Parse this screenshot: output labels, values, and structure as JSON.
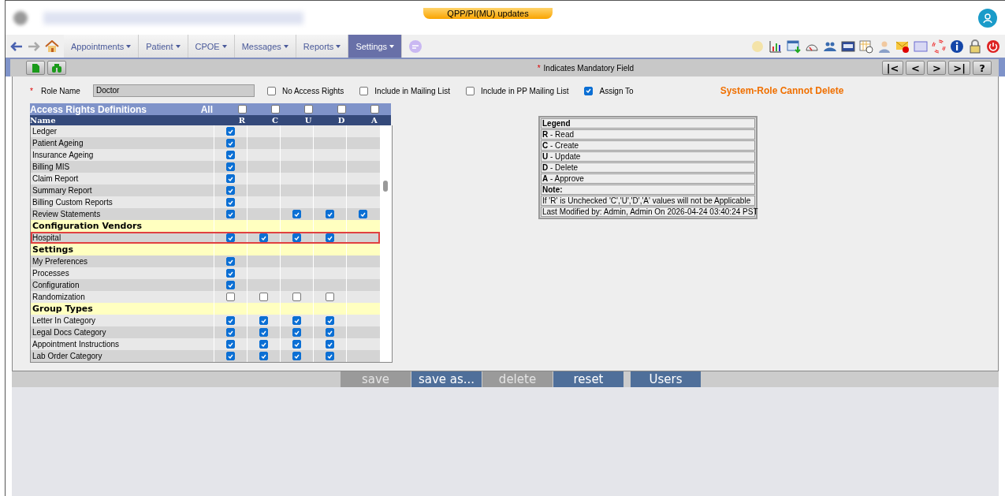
{
  "banner": {
    "label": "QPP/PI(MU) updates"
  },
  "nav": [
    {
      "label": "Appointments",
      "selected": false
    },
    {
      "label": "Patient",
      "selected": false
    },
    {
      "label": "CPOE",
      "selected": false
    },
    {
      "label": "Messages",
      "selected": false
    },
    {
      "label": "Reports",
      "selected": false
    },
    {
      "label": "Settings",
      "selected": true
    }
  ],
  "toolbar": {
    "required_mark": "*",
    "mandatory_note": "Indicates Mandatory Field",
    "pager": [
      "|<",
      "<",
      ">",
      ">|",
      "?"
    ]
  },
  "form": {
    "required_mark": "*",
    "role_label": "Role Name",
    "role_value": "Doctor",
    "options": [
      {
        "label": "No Access Rights",
        "checked": false
      },
      {
        "label": "Include in Mailing List",
        "checked": false
      },
      {
        "label": "Include in PP Mailing List",
        "checked": false
      },
      {
        "label": "Assign To",
        "checked": true
      }
    ],
    "notice": "System-Role Cannot Delete"
  },
  "grid": {
    "title": "Access Rights Definitions",
    "all_label": "All",
    "all_checks": [
      false,
      false,
      false,
      false,
      false
    ],
    "name_label": "Name",
    "columns": [
      "R",
      "C",
      "U",
      "D",
      "A"
    ],
    "rows": [
      {
        "kind": "item",
        "name": "Ledger",
        "selected": false,
        "cells": [
          {
            "kind": "checkbox",
            "checked": true
          },
          {
            "kind": "empty"
          },
          {
            "kind": "empty"
          },
          {
            "kind": "empty"
          },
          {
            "kind": "empty"
          }
        ]
      },
      {
        "kind": "item",
        "name": "Patient Ageing",
        "selected": false,
        "cells": [
          {
            "kind": "checkbox",
            "checked": true
          },
          {
            "kind": "empty"
          },
          {
            "kind": "empty"
          },
          {
            "kind": "empty"
          },
          {
            "kind": "empty"
          }
        ]
      },
      {
        "kind": "item",
        "name": "Insurance Ageing",
        "selected": false,
        "cells": [
          {
            "kind": "checkbox",
            "checked": true
          },
          {
            "kind": "empty"
          },
          {
            "kind": "empty"
          },
          {
            "kind": "empty"
          },
          {
            "kind": "empty"
          }
        ]
      },
      {
        "kind": "item",
        "name": "Billing MIS",
        "selected": false,
        "cells": [
          {
            "kind": "checkbox",
            "checked": true
          },
          {
            "kind": "empty"
          },
          {
            "kind": "empty"
          },
          {
            "kind": "empty"
          },
          {
            "kind": "empty"
          }
        ]
      },
      {
        "kind": "item",
        "name": "Claim Report",
        "selected": false,
        "cells": [
          {
            "kind": "checkbox",
            "checked": true
          },
          {
            "kind": "empty"
          },
          {
            "kind": "empty"
          },
          {
            "kind": "empty"
          },
          {
            "kind": "empty"
          }
        ]
      },
      {
        "kind": "item",
        "name": "Summary Report",
        "selected": false,
        "cells": [
          {
            "kind": "checkbox",
            "checked": true
          },
          {
            "kind": "empty"
          },
          {
            "kind": "empty"
          },
          {
            "kind": "empty"
          },
          {
            "kind": "empty"
          }
        ]
      },
      {
        "kind": "item",
        "name": "Billing Custom Reports",
        "selected": false,
        "cells": [
          {
            "kind": "checkbox",
            "checked": true
          },
          {
            "kind": "empty"
          },
          {
            "kind": "empty"
          },
          {
            "kind": "empty"
          },
          {
            "kind": "empty"
          }
        ]
      },
      {
        "kind": "item",
        "name": "Review Statements",
        "selected": false,
        "cells": [
          {
            "kind": "checkbox",
            "checked": true
          },
          {
            "kind": "empty"
          },
          {
            "kind": "checkbox",
            "checked": true
          },
          {
            "kind": "checkbox",
            "checked": true
          },
          {
            "kind": "checkbox",
            "checked": true
          }
        ]
      },
      {
        "kind": "group",
        "name": "Configuration Vendors"
      },
      {
        "kind": "item",
        "name": "Hospital",
        "selected": true,
        "cells": [
          {
            "kind": "checkbox",
            "checked": true
          },
          {
            "kind": "checkbox",
            "checked": true
          },
          {
            "kind": "checkbox",
            "checked": true
          },
          {
            "kind": "checkbox",
            "checked": true
          },
          {
            "kind": "empty"
          }
        ]
      },
      {
        "kind": "group",
        "name": "Settings"
      },
      {
        "kind": "item",
        "name": "My Preferences",
        "selected": false,
        "cells": [
          {
            "kind": "checkbox",
            "checked": true
          },
          {
            "kind": "empty"
          },
          {
            "kind": "empty"
          },
          {
            "kind": "empty"
          },
          {
            "kind": "empty"
          }
        ]
      },
      {
        "kind": "item",
        "name": "Processes",
        "selected": false,
        "cells": [
          {
            "kind": "checkbox",
            "checked": true
          },
          {
            "kind": "empty"
          },
          {
            "kind": "empty"
          },
          {
            "kind": "empty"
          },
          {
            "kind": "empty"
          }
        ]
      },
      {
        "kind": "item",
        "name": "Configuration",
        "selected": false,
        "cells": [
          {
            "kind": "checkbox",
            "checked": true
          },
          {
            "kind": "empty"
          },
          {
            "kind": "empty"
          },
          {
            "kind": "empty"
          },
          {
            "kind": "empty"
          }
        ]
      },
      {
        "kind": "item",
        "name": "Randomization",
        "selected": false,
        "cells": [
          {
            "kind": "checkbox",
            "checked": false
          },
          {
            "kind": "checkbox",
            "checked": false
          },
          {
            "kind": "checkbox",
            "checked": false
          },
          {
            "kind": "checkbox",
            "checked": false
          },
          {
            "kind": "empty"
          }
        ]
      },
      {
        "kind": "group",
        "name": "Group Types"
      },
      {
        "kind": "item",
        "name": "Letter In Category",
        "selected": false,
        "cells": [
          {
            "kind": "checkbox",
            "checked": true
          },
          {
            "kind": "checkbox",
            "checked": true
          },
          {
            "kind": "checkbox",
            "checked": true
          },
          {
            "kind": "checkbox",
            "checked": true
          },
          {
            "kind": "empty"
          }
        ]
      },
      {
        "kind": "item",
        "name": "Legal Docs Category",
        "selected": false,
        "cells": [
          {
            "kind": "checkbox",
            "checked": true
          },
          {
            "kind": "checkbox",
            "checked": true
          },
          {
            "kind": "checkbox",
            "checked": true
          },
          {
            "kind": "checkbox",
            "checked": true
          },
          {
            "kind": "empty"
          }
        ]
      },
      {
        "kind": "item",
        "name": "Appointment Instructions",
        "selected": false,
        "cells": [
          {
            "kind": "checkbox",
            "checked": true
          },
          {
            "kind": "checkbox",
            "checked": true
          },
          {
            "kind": "checkbox",
            "checked": true
          },
          {
            "kind": "checkbox",
            "checked": true
          },
          {
            "kind": "empty"
          }
        ]
      },
      {
        "kind": "item",
        "name": "Lab Order Category",
        "selected": false,
        "cells": [
          {
            "kind": "checkbox",
            "checked": true
          },
          {
            "kind": "checkbox",
            "checked": true
          },
          {
            "kind": "checkbox",
            "checked": true
          },
          {
            "kind": "checkbox",
            "checked": true
          },
          {
            "kind": "empty"
          }
        ]
      }
    ]
  },
  "legend": {
    "title": "Legend",
    "entries": [
      {
        "key": "R",
        "text": "- Read"
      },
      {
        "key": "C",
        "text": "- Create"
      },
      {
        "key": "U",
        "text": "- Update"
      },
      {
        "key": "D",
        "text": "- Delete"
      },
      {
        "key": "A",
        "text": "- Approve"
      }
    ],
    "note_title": "Note:",
    "note": "If 'R' is Unchecked 'C','U','D','A' values will not be Applicable",
    "modified": "Last Modified by: Admin, Admin On 2026-04-24 03:40:24 PST"
  },
  "actions": [
    {
      "label": "save",
      "disabled": true
    },
    {
      "label": "save as...",
      "disabled": false
    },
    {
      "label": "delete",
      "disabled": true
    },
    {
      "label": "reset",
      "disabled": false
    },
    {
      "label": "Users",
      "disabled": false
    }
  ]
}
